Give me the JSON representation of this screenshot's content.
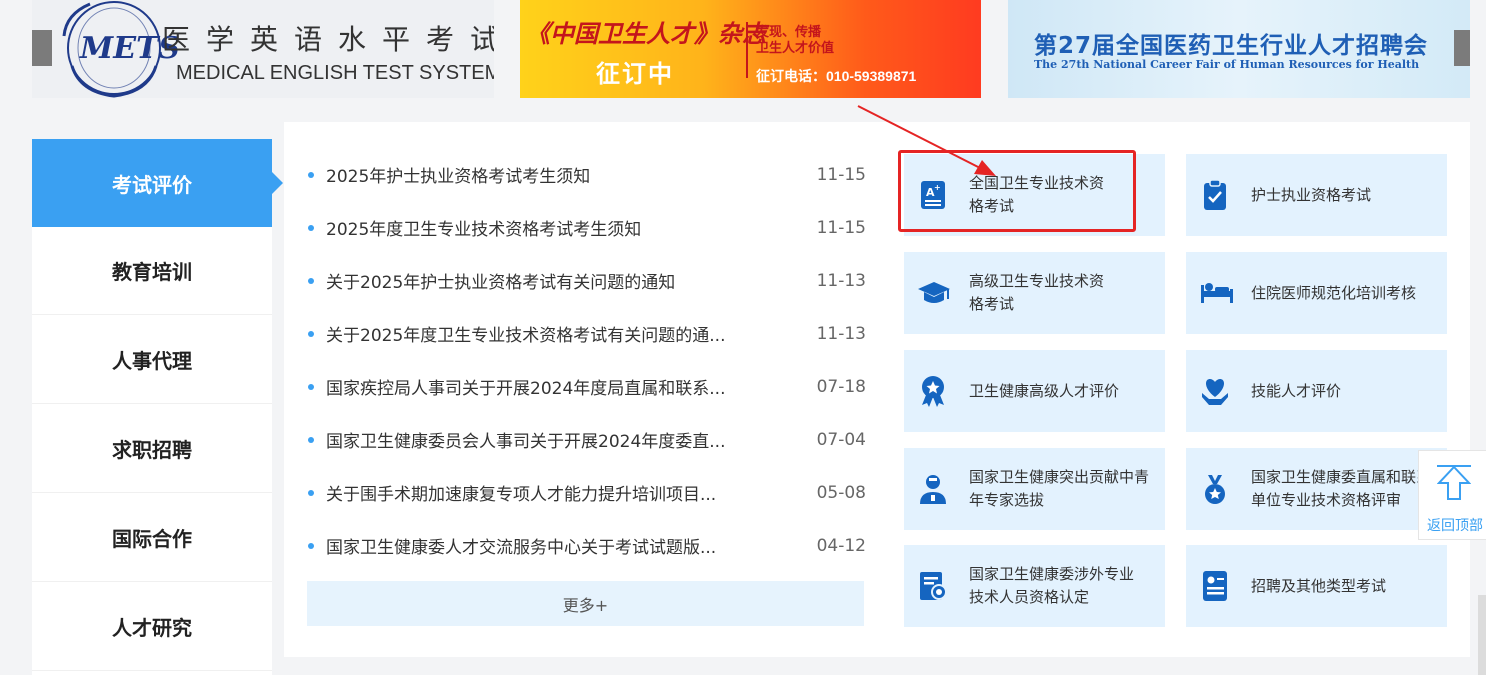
{
  "banners": {
    "mets": {
      "logo_text": "METS",
      "title_cn": "医学英语水平考试",
      "title_en": "MEDICAL ENGLISH TEST SYSTEM"
    },
    "magazine": {
      "title": "《中国卫生人才》杂志",
      "subtitle": "征订中",
      "right_line1": "发现、传播",
      "right_line2": "卫生人才价值",
      "phone": "征订电话：010-59389871"
    },
    "fair": {
      "title": "第27届全国医药卫生行业人才招聘会",
      "subtitle": "The 27th National Career Fair of Human Resources for Health"
    }
  },
  "sidebar": {
    "items": [
      {
        "label": "考试评价",
        "active": true
      },
      {
        "label": "教育培训",
        "active": false
      },
      {
        "label": "人事代理",
        "active": false
      },
      {
        "label": "求职招聘",
        "active": false
      },
      {
        "label": "国际合作",
        "active": false
      },
      {
        "label": "人才研究",
        "active": false
      }
    ]
  },
  "news": {
    "items": [
      {
        "title": "2025年护士执业资格考试考生须知",
        "date": "11-15"
      },
      {
        "title": "2025年度卫生专业技术资格考试考生须知",
        "date": "11-15"
      },
      {
        "title": "关于2025年护士执业资格考试有关问题的通知",
        "date": "11-13"
      },
      {
        "title": "关于2025年度卫生专业技术资格考试有关问题的通...",
        "date": "11-13"
      },
      {
        "title": "国家疾控局人事司关于开展2024年度局直属和联系...",
        "date": "07-18"
      },
      {
        "title": "国家卫生健康委员会人事司关于开展2024年度委直...",
        "date": "07-04"
      },
      {
        "title": "关于围手术期加速康复专项人才能力提升培训项目...",
        "date": "05-08"
      },
      {
        "title": "国家卫生健康委人才交流服务中心关于考试试题版...",
        "date": "04-12"
      }
    ],
    "more_label": "更多+"
  },
  "exams": {
    "tiles": [
      {
        "label": "全国卫生专业技术资格考试",
        "icon": "exam-paper-icon"
      },
      {
        "label": "护士执业资格考试",
        "icon": "clipboard-check-icon"
      },
      {
        "label": "高级卫生专业技术资格考试",
        "icon": "graduation-cap-icon"
      },
      {
        "label": "住院医师规范化培训考核",
        "icon": "hospital-bed-icon"
      },
      {
        "label": "卫生健康高级人才评价",
        "icon": "award-ribbon-icon"
      },
      {
        "label": "技能人才评价",
        "icon": "heart-hand-icon"
      },
      {
        "label": "国家卫生健康突出贡献中青年专家选拔",
        "icon": "doctor-icon"
      },
      {
        "label": "国家卫生健康委直属和联系单位专业技术资格评审",
        "icon": "medal-icon"
      },
      {
        "label": "国家卫生健康委涉外专业技术人员资格认定",
        "icon": "certificate-icon"
      },
      {
        "label": "招聘及其他类型考试",
        "icon": "id-card-icon"
      }
    ]
  },
  "back_to_top": {
    "label": "返回顶部"
  },
  "colors": {
    "accent": "#3aa0f2",
    "tile_bg": "#e3f2fe",
    "highlight": "#e52424",
    "icon": "#1565c0"
  }
}
